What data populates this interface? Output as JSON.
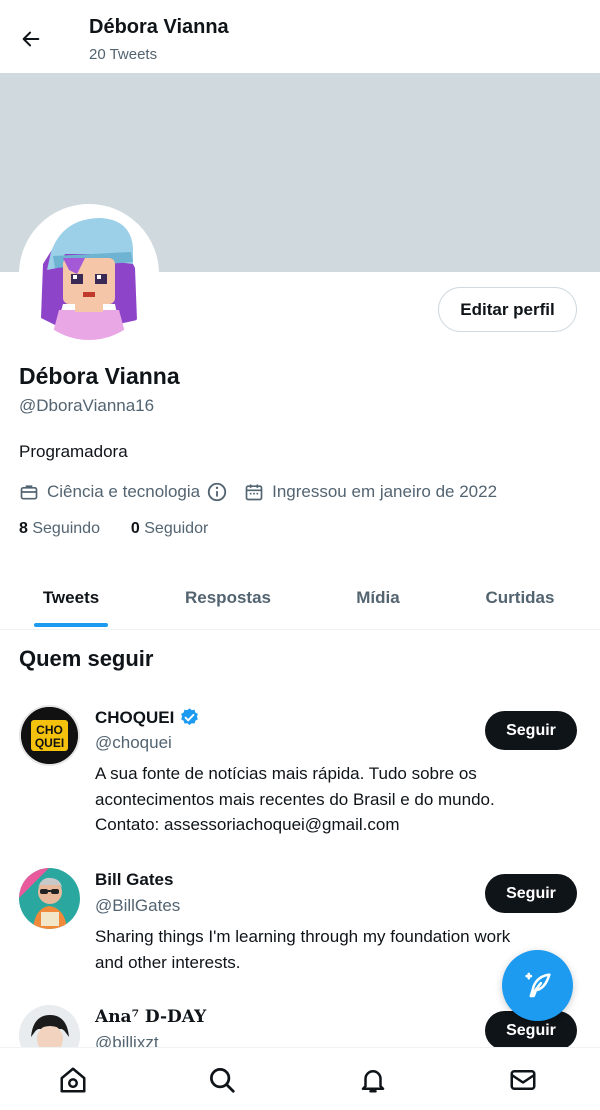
{
  "header": {
    "title": "Débora Vianna",
    "subtitle": "20 Tweets"
  },
  "profile": {
    "name": "Débora Vianna",
    "handle": "@DboraVianna16",
    "bio": "Programadora",
    "category": "Ciência e tecnologia",
    "joined": "Ingressou em janeiro de 2022",
    "following_count": "8",
    "following_label": "Seguindo",
    "followers_count": "0",
    "followers_label": "Seguidor",
    "edit_label": "Editar perfil"
  },
  "tabs": [
    {
      "label": "Tweets",
      "active": true
    },
    {
      "label": "Respostas",
      "active": false
    },
    {
      "label": "Mídia",
      "active": false
    },
    {
      "label": "Curtidas",
      "active": false
    }
  ],
  "who_to_follow": {
    "title": "Quem seguir",
    "items": [
      {
        "name": "CHOQUEI",
        "handle": "@choquei",
        "verified": true,
        "bio_lines": [
          "A sua fonte de notícias mais rápida. Tudo sobre os",
          "acontecimentos mais recentes do Brasil e do mundo.",
          "Contato: assessoriachoquei@gmail.com"
        ],
        "button": "Seguir",
        "avatar_text": [
          "CHO",
          "QUEI"
        ]
      },
      {
        "name": "Bill Gates",
        "handle": "@BillGates",
        "verified": false,
        "bio_lines": [
          "Sharing things I'm learning through my foundation work",
          "and other interests."
        ],
        "button": "Seguir"
      },
      {
        "name": "Ana⁷ D-DAY",
        "handle": "@billixzt",
        "verified": false,
        "button": "Seguir"
      }
    ]
  },
  "colors": {
    "accent": "#1d9bf0",
    "banner": "#cfd9de",
    "text": "#0f1419",
    "muted": "#536471"
  },
  "nav": [
    "home-icon",
    "search-icon",
    "notifications-icon",
    "messages-icon"
  ]
}
